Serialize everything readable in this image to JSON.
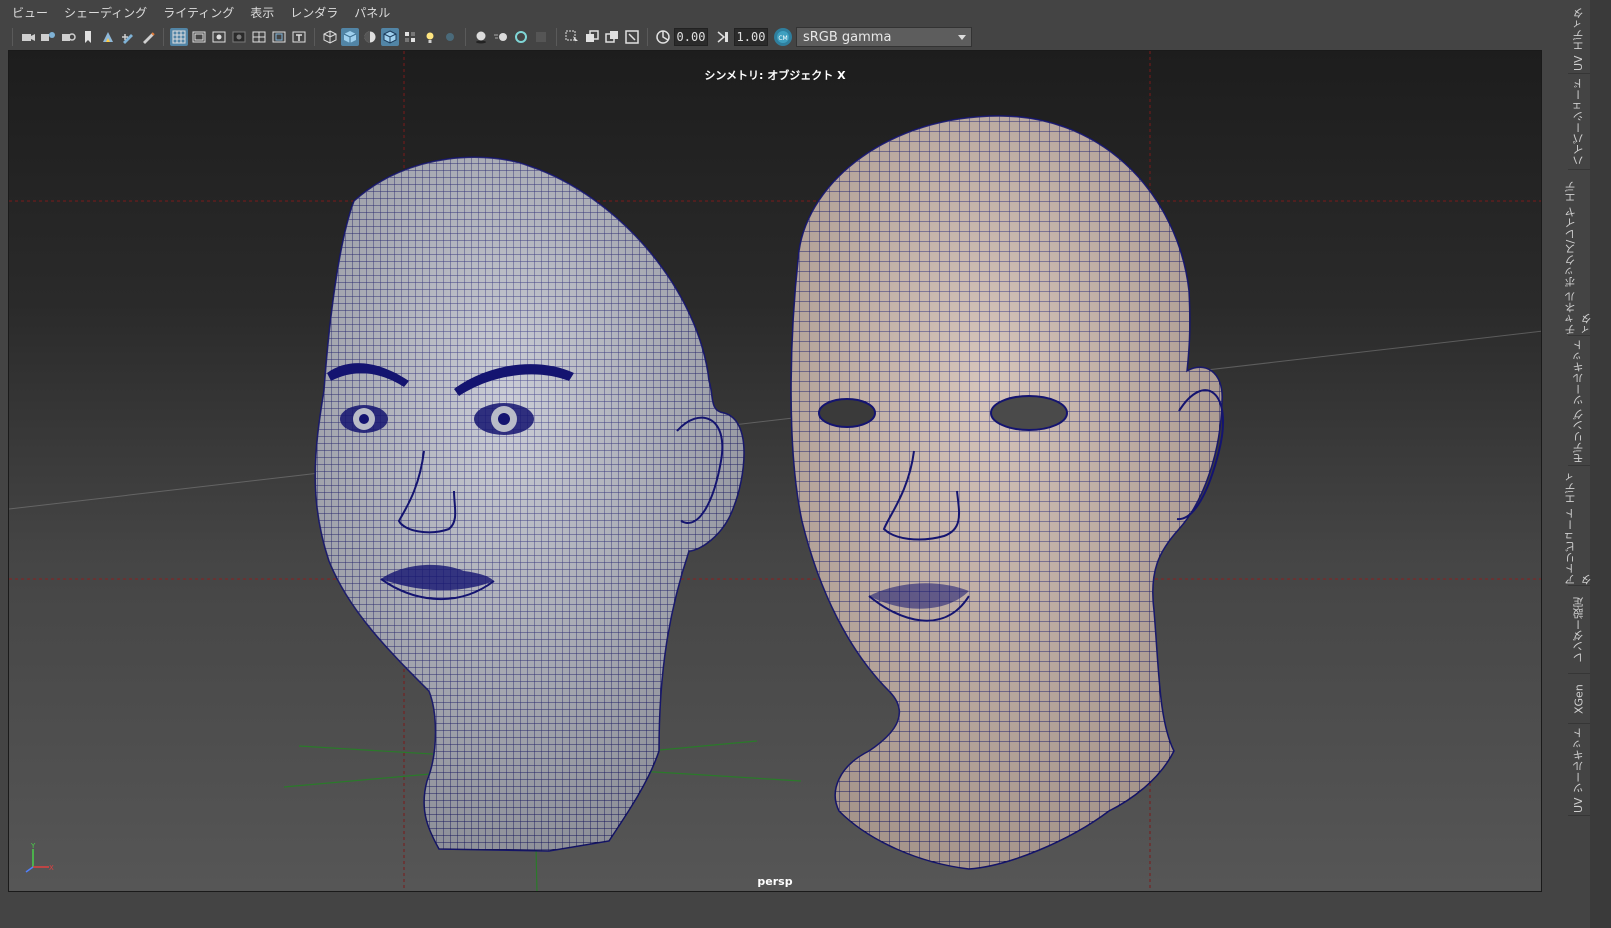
{
  "menu": [
    "ビュー",
    "シェーディング",
    "ライティング",
    "表示",
    "レンダラ",
    "パネル"
  ],
  "toolbar": {
    "icons": [
      "camera-icon",
      "camera-attr-icon",
      "bookmark-icon",
      "image-plane-icon",
      "2d-pan-icon",
      "grease-pencil-icon",
      "grid-icon",
      "film-gate-icon",
      "resolution-gate-icon",
      "gate-mask-icon",
      "field-chart-icon",
      "safe-action-icon",
      "safe-title-icon",
      "wireframe-icon",
      "smooth-shade-icon",
      "default-material-icon",
      "wireframe-on-shaded-icon",
      "textured-icon",
      "lights-icon",
      "shadows-icon",
      "ambient-occlusion-icon",
      "motion-blur-icon",
      "anti-aliasing-icon",
      "depth-of-field-icon",
      "isolate-select-icon",
      "xray-icon",
      "xray-active-icon",
      "xray-joints-icon",
      "exposure-icon",
      "gamma-icon",
      "color-management-icon"
    ],
    "exposure_value": "0.00",
    "gamma_value": "1.00",
    "view_transform": "sRGB gamma"
  },
  "viewport": {
    "symmetry_label": "シンメトリ: オブジェクト X",
    "camera_label": "persp",
    "wire_color": "#141470",
    "mesh_left_color": "#b8bac4",
    "mesh_right_color": "#c9b4a8"
  },
  "dock_tabs": [
    "UV エディタ",
    "ハイパーシェード",
    "チャネル ボックス/レイヤ エディタ",
    "モデリング ツールキット",
    "アトリビュート エディタ",
    "レンダー設定",
    "XGen",
    "UV ツールキット"
  ]
}
